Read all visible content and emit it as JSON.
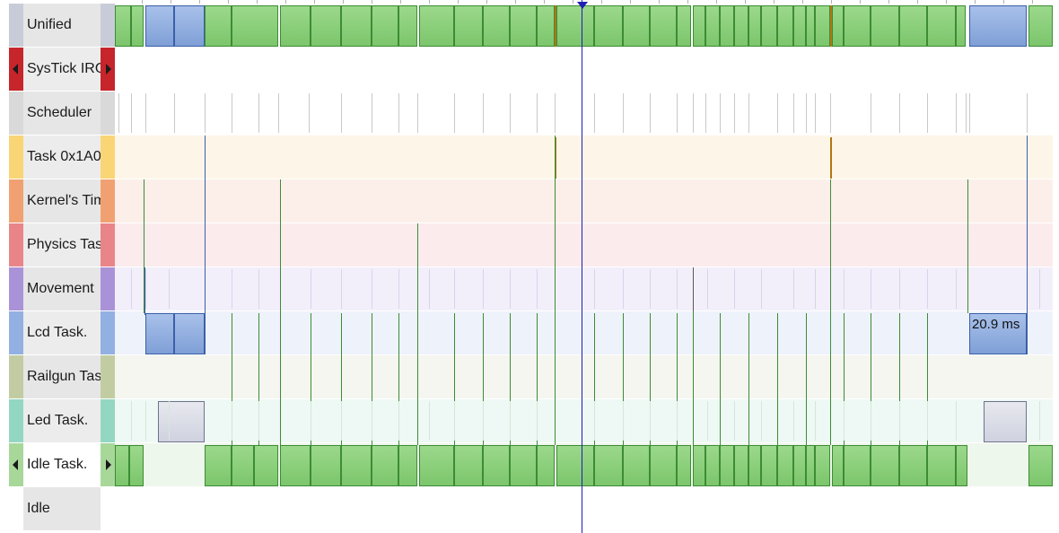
{
  "rows": [
    {
      "label": "Unified",
      "bg": "#e6e6e6",
      "cap": "#c8ccd8",
      "tint": "#ffffff",
      "arrows": false
    },
    {
      "label": "SysTick IRQ",
      "bg": "#ececec",
      "cap": "#c6252b",
      "tint": "#ffffff",
      "arrows": true
    },
    {
      "label": "Scheduler",
      "bg": "#e6e6e6",
      "cap": "#d9d9d9",
      "tint": "#ffffff",
      "arrows": false
    },
    {
      "label": "Task 0x1A0",
      "bg": "#ececec",
      "cap": "#f9d575",
      "tint": "#fdf6e8",
      "arrows": false
    },
    {
      "label": "Kernel's Timer",
      "bg": "#e6e6e6",
      "cap": "#f1a171",
      "tint": "#fcefe9",
      "arrows": false
    },
    {
      "label": "Physics Task",
      "bg": "#ececec",
      "cap": "#e98589",
      "tint": "#fbebed",
      "arrows": false
    },
    {
      "label": "Movement",
      "bg": "#e6e6e6",
      "cap": "#aa92d8",
      "tint": "#f2effa",
      "arrows": false
    },
    {
      "label": "Lcd Task.",
      "bg": "#ececec",
      "cap": "#93b0e2",
      "tint": "#eef2fb",
      "arrows": false
    },
    {
      "label": "Railgun Task",
      "bg": "#e6e6e6",
      "cap": "#c2cca2",
      "tint": "#f4f6ef",
      "arrows": false
    },
    {
      "label": "Led Task.",
      "bg": "#ececec",
      "cap": "#93d7c2",
      "tint": "#eef8f4",
      "arrows": false
    },
    {
      "label": "Idle Task.",
      "bg": "#ffffff",
      "cap": "#a8d79a",
      "tint": "#eef7ec",
      "arrows": true
    },
    {
      "label": "Idle",
      "bg": "#e6e6e6",
      "cap": "#e6e6e6",
      "tint": "#ffffff",
      "arrows": false
    }
  ],
  "annotations": {
    "duration": "20.9 ms"
  },
  "colors": {
    "green": "#8fd07f",
    "blue": "#93b0e2",
    "cursor": "#1f1fb5",
    "event_line": "#3d8c35"
  }
}
